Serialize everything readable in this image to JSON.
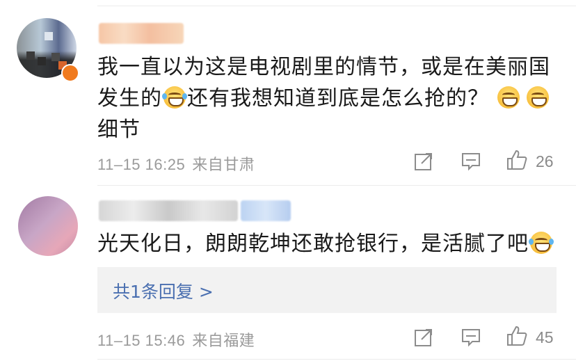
{
  "comments": [
    {
      "text_parts": [
        "我一直以为这是电视剧里的情节，或是在美丽国",
        "发生的",
        "还有我想知道到底是怎么抢的？",
        "细节"
      ],
      "emojis": [
        "laugh-cry-emoji",
        "grin-emoji",
        "grin-emoji"
      ],
      "date": "11–15 16:25",
      "location": "来自甘肃",
      "likes": "26"
    },
    {
      "text": "光天化日，朗朗乾坤还敢抢银行，是活腻了吧",
      "emojis": [
        "laugh-cry-emoji"
      ],
      "reply_link": "共1条回复 >",
      "date": "11–15 15:46",
      "location": "来自福建",
      "likes": "45"
    }
  ],
  "icons": [
    "share-icon",
    "comment-icon",
    "like-icon"
  ],
  "colors": {
    "link": "#4a6fb0",
    "meta": "#9a9a9a",
    "reply_bg": "#f2f2f2"
  }
}
